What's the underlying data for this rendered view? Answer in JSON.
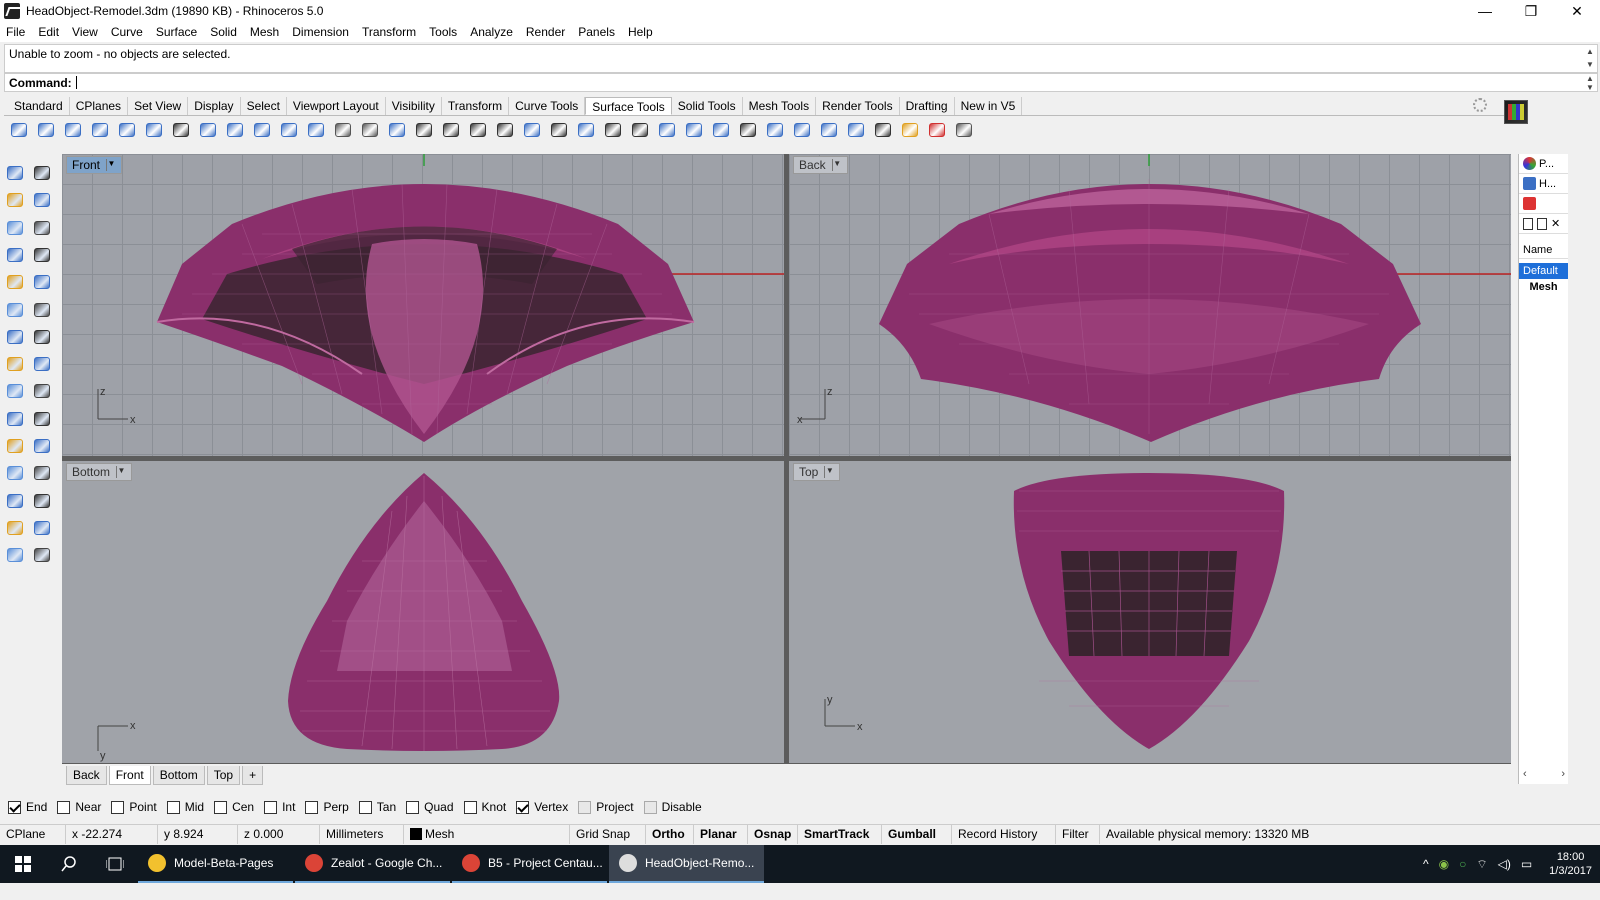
{
  "window": {
    "title": "HeadObject-Remodel.3dm (19890 KB) - Rhinoceros 5.0",
    "min": "—",
    "max": "❐",
    "close": "✕"
  },
  "menu": [
    "File",
    "Edit",
    "View",
    "Curve",
    "Surface",
    "Solid",
    "Mesh",
    "Dimension",
    "Transform",
    "Tools",
    "Analyze",
    "Render",
    "Panels",
    "Help"
  ],
  "command": {
    "history": "Unable to zoom - no objects are selected.",
    "label": "Command:",
    "value": ""
  },
  "toolbar_tabs": [
    "Standard",
    "CPlanes",
    "Set View",
    "Display",
    "Select",
    "Viewport Layout",
    "Visibility",
    "Transform",
    "Curve Tools",
    "Surface Tools",
    "Solid Tools",
    "Mesh Tools",
    "Render Tools",
    "Drafting",
    "New in V5"
  ],
  "toolbar_active_tab": "Surface Tools",
  "toolbar_icons": [
    {
      "name": "extrude-curve-icon",
      "color": "#3b6fc4"
    },
    {
      "name": "extrude-straight-icon",
      "color": "#3b6fc4"
    },
    {
      "name": "extrude-tapered-icon",
      "color": "#3b6fc4"
    },
    {
      "name": "extrude-along-curve-icon",
      "color": "#3b6fc4"
    },
    {
      "name": "extrude-to-point-icon",
      "color": "#3b6fc4"
    },
    {
      "name": "ribbon-icon",
      "color": "#3b6fc4"
    },
    {
      "name": "rail-revolve-icon",
      "color": "#333333"
    },
    {
      "name": "loft-icon",
      "color": "#3b6fc4"
    },
    {
      "name": "sweep1-icon",
      "color": "#3b6fc4"
    },
    {
      "name": "sweep2-icon",
      "color": "#3b6fc4"
    },
    {
      "name": "blend-surface-icon",
      "color": "#3b6fc4"
    },
    {
      "name": "network-srf-icon",
      "color": "#3b6fc4"
    },
    {
      "name": "patch-icon",
      "color": "#555555"
    },
    {
      "name": "arch-surface-icon",
      "color": "#555555"
    },
    {
      "name": "edge-srf-icon",
      "color": "#3b6fc4"
    },
    {
      "name": "fillet-srf-icon",
      "color": "#333333"
    },
    {
      "name": "chamfer-srf-icon",
      "color": "#333333"
    },
    {
      "name": "fit-srf-icon",
      "color": "#333333"
    },
    {
      "name": "degree-srf-icon",
      "color": "#333333"
    },
    {
      "name": "rebuild-srf-icon",
      "color": "#3b6fc4"
    },
    {
      "name": "match-srf-icon",
      "color": "#333333"
    },
    {
      "name": "shrink-trimmed-icon",
      "color": "#3b6fc4"
    },
    {
      "name": "untrim-icon",
      "color": "#333333"
    },
    {
      "name": "points-on-icon",
      "color": "#333333"
    },
    {
      "name": "unroll-icon",
      "color": "#3b6fc4"
    },
    {
      "name": "cylinder-icon",
      "color": "#3b6fc4"
    },
    {
      "name": "plane-corner-icon",
      "color": "#3b6fc4"
    },
    {
      "name": "split-srf-icon",
      "color": "#333333"
    },
    {
      "name": "merge-srf-icon",
      "color": "#3b6fc4"
    },
    {
      "name": "join-srf-icon",
      "color": "#3b6fc4"
    },
    {
      "name": "explode-icon",
      "color": "#3b6fc4"
    },
    {
      "name": "flow-srf-icon",
      "color": "#3b6fc4"
    },
    {
      "name": "contour-icon",
      "color": "#333333"
    },
    {
      "name": "zebra-analysis-icon",
      "color": "#e0a020"
    },
    {
      "name": "box-edit-icon",
      "color": "#d03030"
    },
    {
      "name": "curvature-graph-icon",
      "color": "#555555"
    }
  ],
  "left_tools": [
    "select-arrow-icon",
    "point-curve-icon",
    "polyline-icon",
    "line-icon",
    "curve-interpolate-icon",
    "curve-control-point-icon",
    "surface-icon",
    "plane-icon",
    "sphere-icon",
    "box-icon",
    "extrude-icon",
    "revolve-icon",
    "trim-icon",
    "split-icon",
    "fillet-icon",
    "offset-icon",
    "boolean-icon",
    "mirror-icon",
    "move-icon",
    "rotate-icon",
    "array-icon",
    "scale-icon",
    "dimension-icon",
    "text-icon",
    "group-icon",
    "ungroup-icon",
    "cage-edit-icon",
    "mesh-icon",
    "render-icon",
    "grid-icon"
  ],
  "viewports": [
    {
      "label": "Front",
      "active": true
    },
    {
      "label": "Back",
      "active": false
    },
    {
      "label": "Bottom",
      "active": false
    },
    {
      "label": "Top",
      "active": false
    }
  ],
  "axis_letters": {
    "front": [
      "z",
      "x"
    ],
    "back": [
      "z",
      "x"
    ],
    "bottom": [
      "x",
      "y"
    ],
    "top": [
      "y",
      "x"
    ]
  },
  "viewport_tabs": [
    "Back",
    "Front",
    "Bottom",
    "Top",
    "+"
  ],
  "viewport_tab_active": "Front",
  "layers_panel": {
    "tab1": "P...",
    "tab2": "H...",
    "column": "Name",
    "default_layer": "Default",
    "mesh_layer": "Mesh",
    "scroll_left": "‹",
    "scroll_right": "›"
  },
  "osnaps": [
    {
      "label": "End",
      "checked": true,
      "enabled": true
    },
    {
      "label": "Near",
      "checked": false,
      "enabled": true
    },
    {
      "label": "Point",
      "checked": false,
      "enabled": true
    },
    {
      "label": "Mid",
      "checked": false,
      "enabled": true
    },
    {
      "label": "Cen",
      "checked": false,
      "enabled": true
    },
    {
      "label": "Int",
      "checked": false,
      "enabled": true
    },
    {
      "label": "Perp",
      "checked": false,
      "enabled": true
    },
    {
      "label": "Tan",
      "checked": false,
      "enabled": true
    },
    {
      "label": "Quad",
      "checked": false,
      "enabled": true
    },
    {
      "label": "Knot",
      "checked": false,
      "enabled": true
    },
    {
      "label": "Vertex",
      "checked": true,
      "enabled": true
    },
    {
      "label": "Project",
      "checked": false,
      "enabled": false
    },
    {
      "label": "Disable",
      "checked": false,
      "enabled": false
    }
  ],
  "status": {
    "cplane": "CPlane",
    "x": "x -22.274",
    "y": "y 8.924",
    "z": "z 0.000",
    "units": "Millimeters",
    "layer": "Mesh",
    "grid_snap": "Grid Snap",
    "ortho": "Ortho",
    "planar": "Planar",
    "osnap": "Osnap",
    "smarttrack": "SmartTrack",
    "gumball": "Gumball",
    "record_history": "Record History",
    "filter": "Filter",
    "memory": "Available physical memory: 13320 MB"
  },
  "taskbar": {
    "apps": [
      {
        "label": "Model-Beta-Pages",
        "color": "#f2c12e",
        "active": false
      },
      {
        "label": "Zealot - Google Ch...",
        "color": "#db4437",
        "active": false
      },
      {
        "label": "B5 - Project Centau...",
        "color": "#db4437",
        "active": false
      },
      {
        "label": "HeadObject-Remo...",
        "color": "#dddddd",
        "active": true
      }
    ],
    "time": "18:00",
    "date": "1/3/2017"
  },
  "colors": {
    "mesh": "#8a2f6b",
    "mesh_dark": "#3a2430",
    "viewport_bg": "#9ea1a8",
    "active_label": "#7fa3c9",
    "selected_layer": "#1e6fd9"
  }
}
